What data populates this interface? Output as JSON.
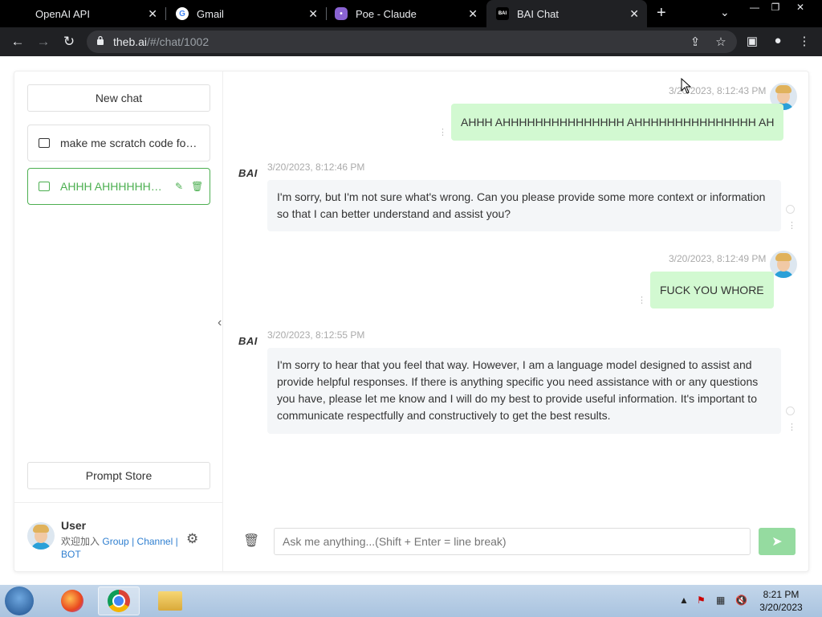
{
  "browser": {
    "tabs": [
      {
        "title": "OpenAI API",
        "icon": "openai-icon"
      },
      {
        "title": "Gmail",
        "icon": "google-icon"
      },
      {
        "title": "Poe - Claude",
        "icon": "poe-icon"
      },
      {
        "title": "BAI Chat",
        "icon": "bai-icon",
        "active": true
      }
    ],
    "url_host": "theb.ai",
    "url_path": "/#/chat/1002"
  },
  "sidebar": {
    "new_chat": "New chat",
    "chats": [
      {
        "label": "make me scratch code for ..."
      },
      {
        "label": "AHHH AHHHHHHHHHHHHHHH AHHHHHHHHHHHHHHH AH",
        "active": true
      }
    ],
    "prompt_store": "Prompt Store",
    "user": {
      "name": "User",
      "join_text": "欢迎加入",
      "group": "Group",
      "sep1": "|",
      "channel": "Channel",
      "sep2": "|",
      "bot": "BOT"
    }
  },
  "chat": {
    "bot_logo": "BAI",
    "messages": [
      {
        "role": "user",
        "time": "3/20/2023, 8:12:43 PM",
        "text": "AHHH AHHHHHHHHHHHHHHH AHHHHHHHHHHHHHHH AH"
      },
      {
        "role": "bot",
        "time": "3/20/2023, 8:12:46 PM",
        "text": "I'm sorry, but I'm not sure what's wrong. Can you please provide some more context or information so that I can better understand and assist you?"
      },
      {
        "role": "user",
        "time": "3/20/2023, 8:12:49 PM",
        "text": "FUCK YOU WHORE"
      },
      {
        "role": "bot",
        "time": "3/20/2023, 8:12:55 PM",
        "text": "I'm sorry to hear that you feel that way. However, I am a language model designed to assist and provide helpful responses. If there is anything specific you need assistance with or any questions you have, please let me know and I will do my best to provide useful information. It's important to communicate respectfully and constructively to get the best results."
      }
    ],
    "input_placeholder": "Ask me anything...(Shift + Enter = line break)"
  },
  "taskbar": {
    "time": "8:21 PM",
    "date": "3/20/2023"
  },
  "colors": {
    "accent": "#4caf50",
    "user_bubble": "#d2f9d1",
    "bot_bubble": "#f4f6f8",
    "send_button": "#95dba0"
  }
}
